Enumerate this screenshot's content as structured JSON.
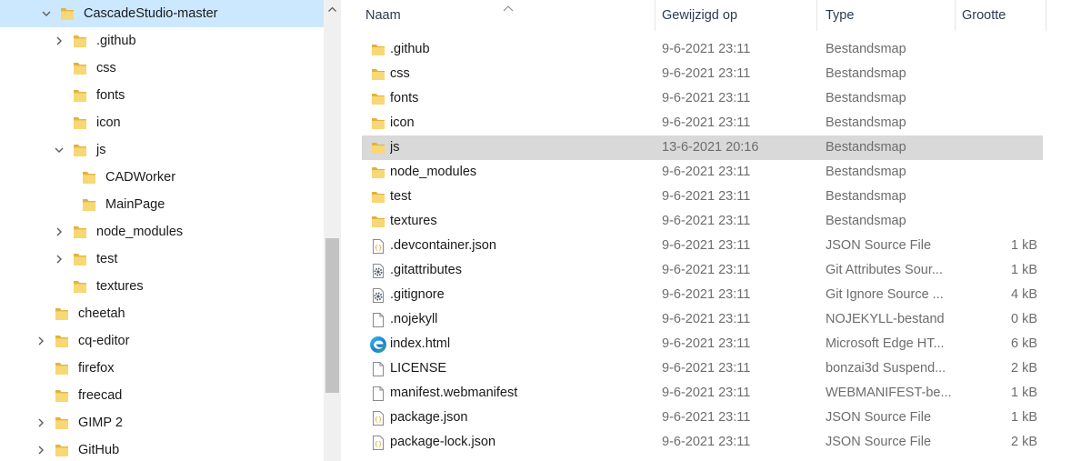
{
  "navigation": {
    "items": [
      {
        "label": "CascadeStudio-master",
        "level": 1,
        "expander": "expanded",
        "selected": true
      },
      {
        "label": ".github",
        "level": 2,
        "expander": "collapsed"
      },
      {
        "label": "css",
        "level": 2,
        "expander": "none"
      },
      {
        "label": "fonts",
        "level": 2,
        "expander": "none"
      },
      {
        "label": "icon",
        "level": 2,
        "expander": "none"
      },
      {
        "label": "js",
        "level": 2,
        "expander": "expanded"
      },
      {
        "label": "CADWorker",
        "level": 3,
        "expander": "none"
      },
      {
        "label": "MainPage",
        "level": 3,
        "expander": "none"
      },
      {
        "label": "node_modules",
        "level": 2,
        "expander": "collapsed"
      },
      {
        "label": "test",
        "level": 2,
        "expander": "collapsed"
      },
      {
        "label": "textures",
        "level": 2,
        "expander": "none"
      },
      {
        "label": "cheetah",
        "level": 0,
        "expander": "none"
      },
      {
        "label": "cq-editor",
        "level": 0,
        "expander": "collapsed"
      },
      {
        "label": "firefox",
        "level": 0,
        "expander": "none"
      },
      {
        "label": "freecad",
        "level": 0,
        "expander": "none"
      },
      {
        "label": "GIMP 2",
        "level": 0,
        "expander": "collapsed"
      },
      {
        "label": "GitHub",
        "level": 0,
        "expander": "collapsed"
      }
    ]
  },
  "file_list": {
    "columns": {
      "name": "Naam",
      "modified": "Gewijzigd op",
      "type": "Type",
      "size": "Grootte"
    },
    "rows": [
      {
        "icon": "folder-icon",
        "name": ".github",
        "modified": "9-6-2021 23:11",
        "type": "Bestandsmap",
        "size": ""
      },
      {
        "icon": "folder-icon",
        "name": "css",
        "modified": "9-6-2021 23:11",
        "type": "Bestandsmap",
        "size": ""
      },
      {
        "icon": "folder-icon",
        "name": "fonts",
        "modified": "9-6-2021 23:11",
        "type": "Bestandsmap",
        "size": ""
      },
      {
        "icon": "folder-icon",
        "name": "icon",
        "modified": "9-6-2021 23:11",
        "type": "Bestandsmap",
        "size": ""
      },
      {
        "icon": "folder-icon",
        "name": "js",
        "modified": "13-6-2021 20:16",
        "type": "Bestandsmap",
        "size": "",
        "selected": true
      },
      {
        "icon": "folder-icon",
        "name": "node_modules",
        "modified": "9-6-2021 23:11",
        "type": "Bestandsmap",
        "size": ""
      },
      {
        "icon": "folder-icon",
        "name": "test",
        "modified": "9-6-2021 23:11",
        "type": "Bestandsmap",
        "size": ""
      },
      {
        "icon": "folder-icon",
        "name": "textures",
        "modified": "9-6-2021 23:11",
        "type": "Bestandsmap",
        "size": ""
      },
      {
        "icon": "json-file-icon",
        "name": ".devcontainer.json",
        "modified": "9-6-2021 23:11",
        "type": "JSON Source File",
        "size": "1 kB"
      },
      {
        "icon": "settings-file-icon",
        "name": ".gitattributes",
        "modified": "9-6-2021 23:11",
        "type": "Git Attributes Sour...",
        "size": "1 kB"
      },
      {
        "icon": "settings-file-icon",
        "name": ".gitignore",
        "modified": "9-6-2021 23:11",
        "type": "Git Ignore Source ...",
        "size": "4 kB"
      },
      {
        "icon": "blank-file-icon",
        "name": ".nojekyll",
        "modified": "9-6-2021 23:11",
        "type": "NOJEKYLL-bestand",
        "size": "0 kB"
      },
      {
        "icon": "edge-icon",
        "name": "index.html",
        "modified": "9-6-2021 23:11",
        "type": "Microsoft Edge HT...",
        "size": "6 kB"
      },
      {
        "icon": "blank-file-icon",
        "name": "LICENSE",
        "modified": "9-6-2021 23:11",
        "type": "bonzai3d Suspend...",
        "size": "2 kB"
      },
      {
        "icon": "blank-file-icon",
        "name": "manifest.webmanifest",
        "modified": "9-6-2021 23:11",
        "type": "WEBMANIFEST-be...",
        "size": "1 kB"
      },
      {
        "icon": "json-file-icon",
        "name": "package.json",
        "modified": "9-6-2021 23:11",
        "type": "JSON Source File",
        "size": "1 kB"
      },
      {
        "icon": "json-file-icon",
        "name": "package-lock.json",
        "modified": "9-6-2021 23:11",
        "type": "JSON Source File",
        "size": "2 kB"
      }
    ]
  },
  "colors": {
    "nav_selected": "#cce8ff",
    "row_selected": "#d9d9d9",
    "folder_yellow": "#f8d775",
    "header_text": "#2b3a55"
  }
}
